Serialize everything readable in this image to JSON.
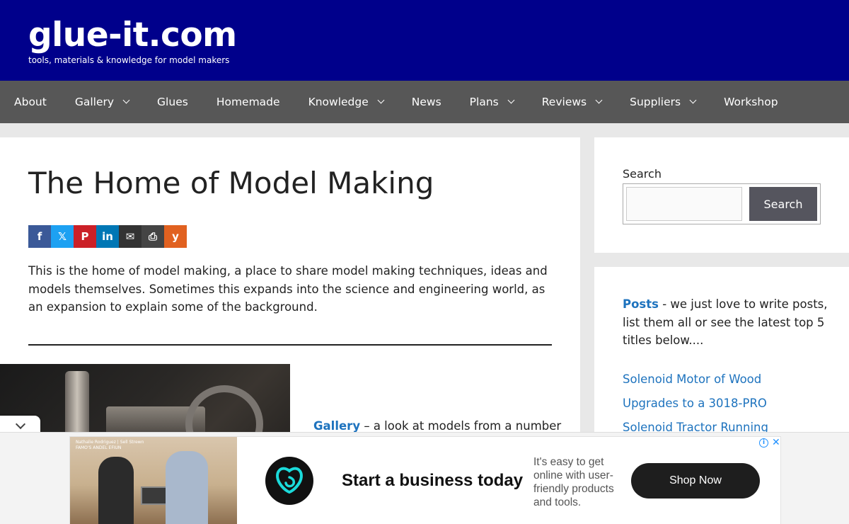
{
  "header": {
    "site_title": "glue-it.com",
    "tagline": "tools, materials & knowledge for model makers",
    "background_color": "#00008b"
  },
  "nav": {
    "items": [
      {
        "label": "About",
        "has_dropdown": false
      },
      {
        "label": "Gallery",
        "has_dropdown": true
      },
      {
        "label": "Glues",
        "has_dropdown": false
      },
      {
        "label": "Homemade",
        "has_dropdown": false
      },
      {
        "label": "Knowledge",
        "has_dropdown": true
      },
      {
        "label": "News",
        "has_dropdown": false
      },
      {
        "label": "Plans",
        "has_dropdown": true
      },
      {
        "label": "Reviews",
        "has_dropdown": true
      },
      {
        "label": "Suppliers",
        "has_dropdown": true
      },
      {
        "label": "Workshop",
        "has_dropdown": false
      }
    ]
  },
  "main": {
    "title": "The Home of Model Making",
    "share_buttons": [
      {
        "name": "facebook",
        "glyph": "f",
        "color": "#3b5998"
      },
      {
        "name": "x-twitter",
        "glyph": "𝕏",
        "color": "#1da1f2"
      },
      {
        "name": "pinterest",
        "glyph": "P",
        "color": "#cb2027"
      },
      {
        "name": "linkedin",
        "glyph": "in",
        "color": "#0077b5"
      },
      {
        "name": "email",
        "glyph": "✉",
        "color": "#333333"
      },
      {
        "name": "print",
        "glyph": "⎙",
        "color": "#444444"
      },
      {
        "name": "yummly",
        "glyph": "y",
        "color": "#e16120"
      }
    ],
    "intro": "This is the home of model making, a place to share model making techniques, ideas and models themselves. Sometimes this expands into the science and engineering world, as an expansion to explain some of the background.",
    "gallery_link": "Gallery",
    "gallery_text": " – a look at models from a number"
  },
  "sidebar": {
    "search_label": "Search",
    "search_button": "Search",
    "search_value": "",
    "posts_link": "Posts",
    "posts_text": " - we just love to write posts, list them all or see the latest top 5 titles below....",
    "recent_posts": [
      "Solenoid Motor of Wood",
      "Upgrades to a 3018-PRO",
      "Solenoid Tractor Running"
    ]
  },
  "ad": {
    "photo_caption": "Nathalie Rodriguez | Sell Strewn\nFAMO'S ANDEL EFIUN",
    "headline": "Start a business today",
    "description": "It's easy to get online with user-friendly products and tools.",
    "cta": "Shop Now",
    "info_glyph": "i",
    "close_glyph": "✕"
  },
  "colors": {
    "nav_bg": "#575757",
    "link": "#1e73be",
    "search_button_bg": "#55555e"
  }
}
